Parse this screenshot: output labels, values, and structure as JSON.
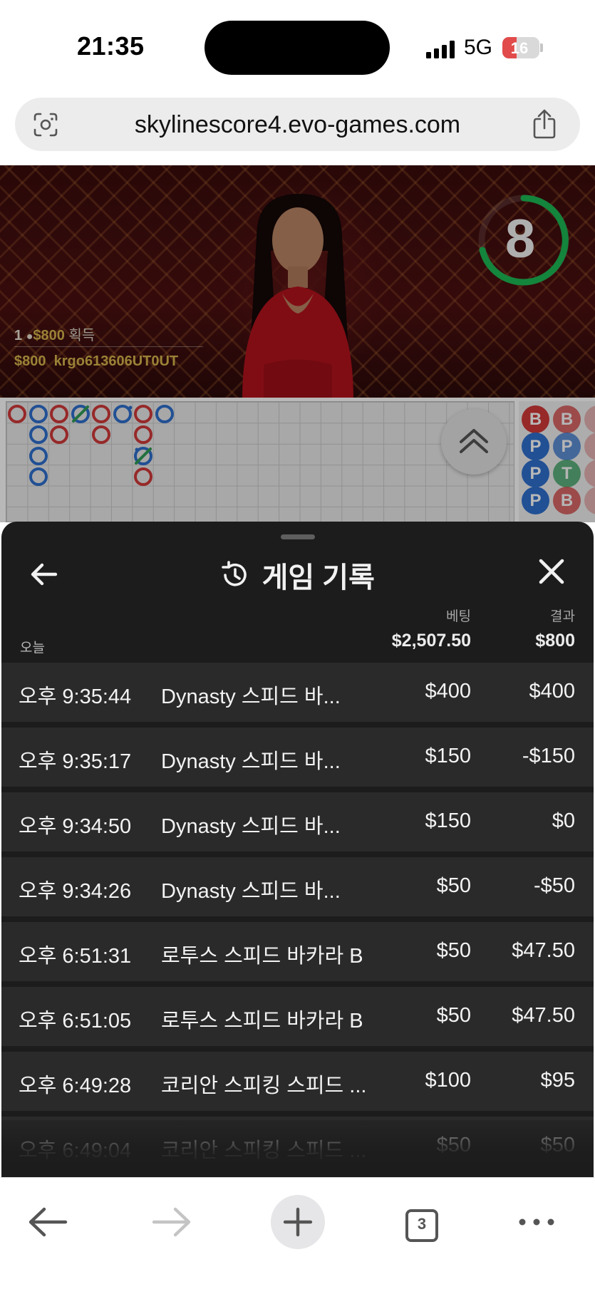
{
  "status_bar": {
    "time": "21:35",
    "network": "5G",
    "battery": "16",
    "battery_color": "#e24b4b"
  },
  "browser": {
    "url": "skylinescore4.evo-games.com",
    "icons": [
      "lens-icon",
      "share-icon"
    ],
    "toolbar": {
      "icons": [
        "back-arrow-icon",
        "forward-arrow-icon",
        "plus-icon",
        "tabs-icon",
        "more-icon"
      ],
      "tab_count": "3"
    }
  },
  "video": {
    "timer": "8",
    "timer_color": "#1db954",
    "winner_count": "1",
    "winner_amount": "$800",
    "winner_suffix": "획득",
    "winner_detail_amount": "$800",
    "winner_detail_user": "krgo613606UT0UT",
    "gold_color": "#d6b44c"
  },
  "scoreboard": {
    "bead_road": [
      [
        "B",
        "B"
      ],
      [
        "P",
        "P"
      ],
      [
        "P",
        "T"
      ],
      [
        "P",
        "B"
      ]
    ],
    "colors": {
      "banker": "#d23a3a",
      "player": "#2f6fce",
      "tie": "#2e9b57"
    }
  },
  "sheet": {
    "title": "게임 기록",
    "icons": [
      "back-arrow-icon",
      "history-icon",
      "close-icon"
    ],
    "header": {
      "today_label": "오늘",
      "bet_label": "베팅",
      "result_label": "결과",
      "bet_total": "$2,507.50",
      "result_total": "$800"
    },
    "rows": [
      {
        "time": "오후 9:35:44",
        "game": "Dynasty 스피드 바...",
        "bet": "$400",
        "result": "$400"
      },
      {
        "time": "오후 9:35:17",
        "game": "Dynasty 스피드 바...",
        "bet": "$150",
        "result": "-$150"
      },
      {
        "time": "오후 9:34:50",
        "game": "Dynasty 스피드 바...",
        "bet": "$150",
        "result": "$0"
      },
      {
        "time": "오후 9:34:26",
        "game": "Dynasty 스피드 바...",
        "bet": "$50",
        "result": "-$50"
      },
      {
        "time": "오후 6:51:31",
        "game": "로투스 스피드 바카라 B",
        "bet": "$50",
        "result": "$47.50"
      },
      {
        "time": "오후 6:51:05",
        "game": "로투스 스피드 바카라 B",
        "bet": "$50",
        "result": "$47.50"
      },
      {
        "time": "오후 6:49:28",
        "game": "코리안 스피킹 스피드 ...",
        "bet": "$100",
        "result": "$95"
      },
      {
        "time": "오후 6:49:04",
        "game": "코리안 스피킹 스피드 ...",
        "bet": "$50",
        "result": "$50"
      }
    ]
  }
}
